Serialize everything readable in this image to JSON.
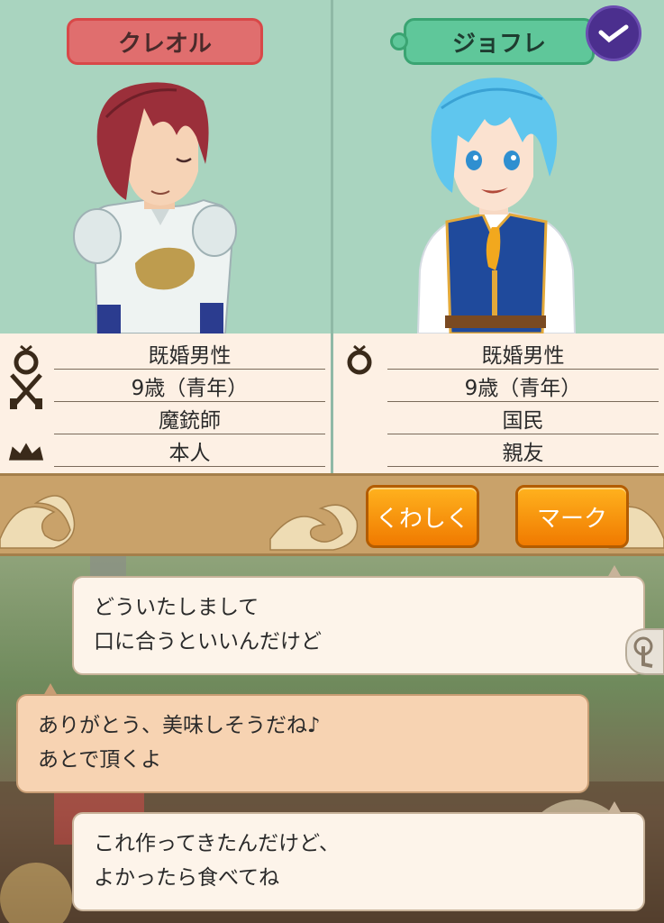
{
  "left_character": {
    "name": "クレオル",
    "info": {
      "marital": "既婚男性",
      "age": "9歳（青年）",
      "job": "魔銃師",
      "relation": "本人"
    }
  },
  "right_character": {
    "name": "ジョフレ",
    "info": {
      "marital": "既婚男性",
      "age": "9歳（青年）",
      "job": "国民",
      "relation": "親友"
    }
  },
  "actions": {
    "details_label": "くわしく",
    "mark_label": "マーク"
  },
  "chat": {
    "messages": [
      {
        "line1": "どういたしまして",
        "line2": "口に合うといいんだけど"
      },
      {
        "line1": "ありがとう、美味しそうだね♪",
        "line2": "あとで頂くよ"
      },
      {
        "line1": "これ作ってきたんだけど、",
        "line2": "よかったら食べてね"
      }
    ]
  },
  "icons": {
    "check": "check-badge-icon",
    "ring": "ring-icon",
    "weapons": "crossed-guns-icon",
    "crown": "crown-icon",
    "touch": "touch-icon"
  },
  "colors": {
    "name_red": "#e06e6e",
    "name_green": "#5fc79a",
    "button_orange": "#f59010",
    "check_purple": "#4b2f8e",
    "panel_bg": "#a9d4bf"
  }
}
